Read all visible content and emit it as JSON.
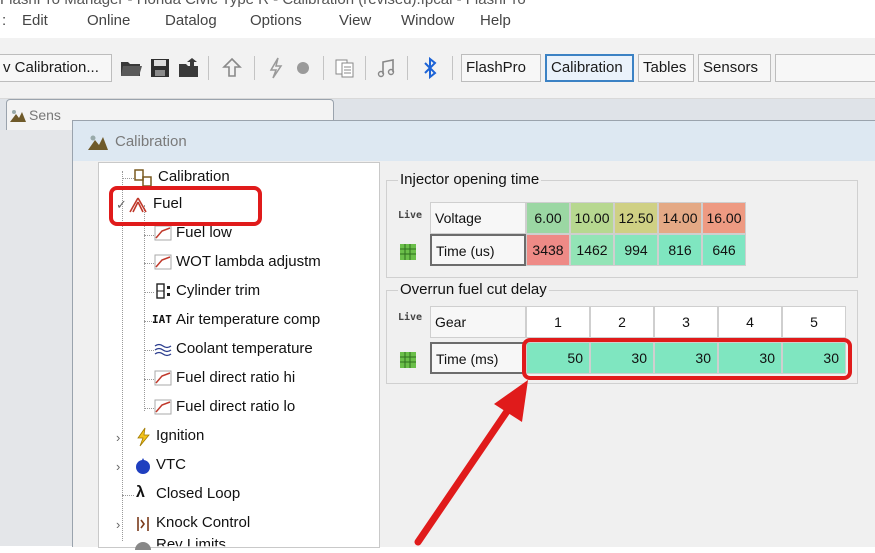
{
  "app": {
    "title_strip": "FlashPro Manager - Honda Civic Type R - Calibration (revised).fpcal - FlashPro"
  },
  "menu": {
    "items": [
      "Edit",
      "Online",
      "Datalog",
      "Options",
      "View",
      "Window",
      "Help"
    ]
  },
  "toolbar": {
    "calibration_btn": "v Calibration...",
    "flashpro_btn": "FlashPro",
    "calibration_tab_btn": "Calibration",
    "tables_btn": "Tables",
    "sensors_btn": "Sensors"
  },
  "sensors_tab": {
    "label": "Sens"
  },
  "calibration_window": {
    "title": "Calibration"
  },
  "tree": {
    "root": "Calibration",
    "fuel": "Fuel",
    "fuel_children": [
      "Fuel low",
      "WOT lambda adjustm",
      "Cylinder trim",
      "Air temperature comp",
      "Coolant temperature",
      "Fuel direct ratio hi",
      "Fuel direct ratio lo"
    ],
    "others": [
      "Ignition",
      "VTC",
      "Closed Loop",
      "Knock Control"
    ],
    "cutoff": "Rev Limits"
  },
  "injector": {
    "title": "Injector opening time",
    "live": "Live",
    "row1_label": "Voltage",
    "row2_label": "Time (us)",
    "voltage": [
      "6.00",
      "10.00",
      "12.50",
      "14.00",
      "16.00"
    ],
    "time_us": [
      "3438",
      "1462",
      "994",
      "816",
      "646"
    ]
  },
  "overrun": {
    "title": "Overrun fuel cut delay",
    "live": "Live",
    "row1_label": "Gear",
    "row2_label": "Time (ms)",
    "gears": [
      "1",
      "2",
      "3",
      "4",
      "5"
    ],
    "time_ms": [
      "50",
      "30",
      "30",
      "30",
      "30"
    ]
  },
  "colors": {
    "annotation_red": "#e01b1b",
    "active_tab_blue": "#3b82c4"
  }
}
